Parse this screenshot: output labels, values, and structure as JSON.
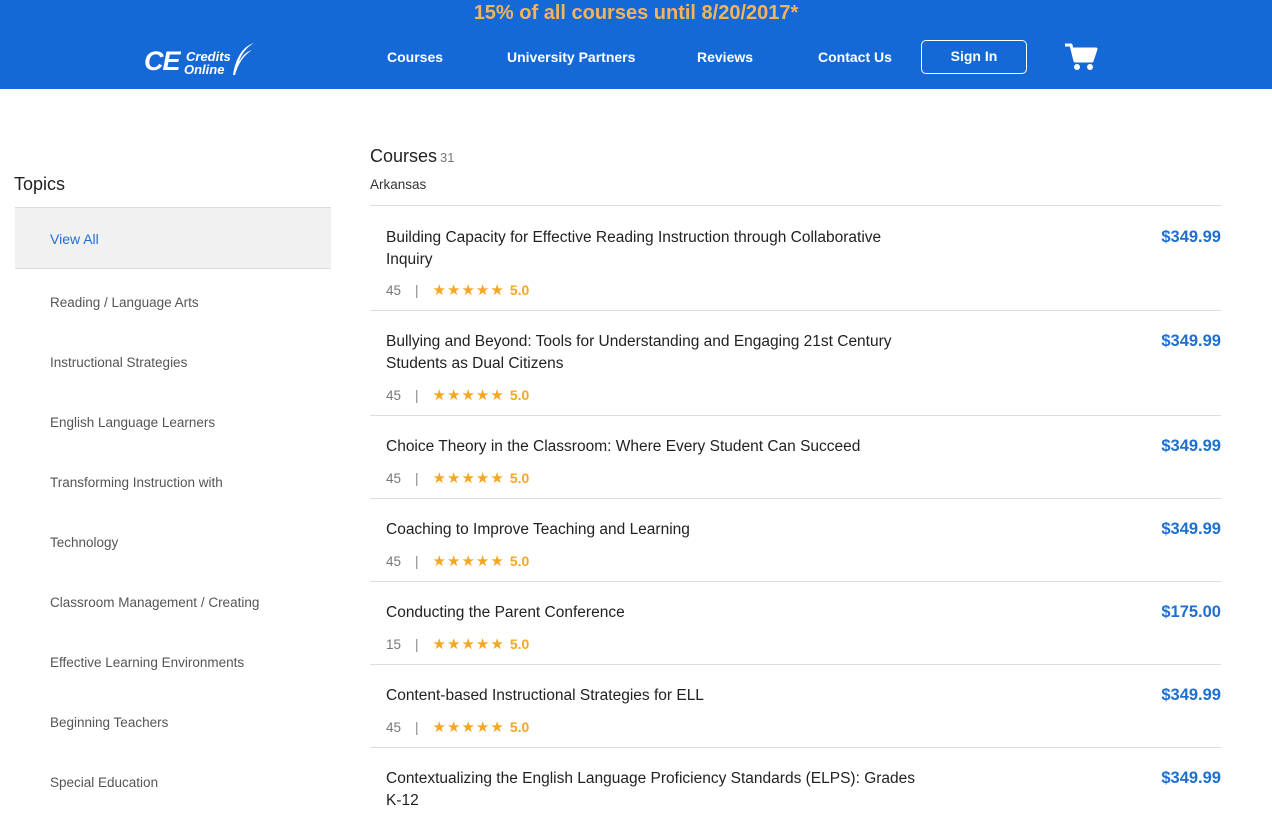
{
  "header": {
    "promo": "15% of all courses until 8/20/2017*",
    "logo": {
      "ce": "CE",
      "credits": "Credits",
      "online": "Online"
    },
    "nav": [
      "Courses",
      "University Partners",
      "Reviews",
      "Contact Us"
    ],
    "signin_label": "Sign In",
    "cart_icon": "shopping-cart-icon"
  },
  "sidebar": {
    "title": "Topics",
    "items": [
      "View All",
      "Reading / Language Arts",
      "Instructional Strategies",
      "English Language Learners",
      "Transforming Instruction with",
      "Technology",
      "Classroom Management / Creating",
      "Effective Learning Environments",
      "Beginning Teachers",
      "Special Education"
    ]
  },
  "main": {
    "title": "Courses",
    "count": "31",
    "state": "Arkansas",
    "courses": [
      {
        "title": "Building Capacity for Effective Reading Instruction through Collaborative Inquiry",
        "hours": "45",
        "rating": "5.0",
        "stars": 5,
        "price": "$349.99"
      },
      {
        "title": "Bullying and Beyond: Tools for Understanding and Engaging 21st Century Students as Dual Citizens",
        "hours": "45",
        "rating": "5.0",
        "stars": 5,
        "price": "$349.99"
      },
      {
        "title": "Choice Theory in the Classroom: Where Every Student Can Succeed",
        "hours": "45",
        "rating": "5.0",
        "stars": 5,
        "price": "$349.99"
      },
      {
        "title": "Coaching to Improve Teaching and Learning",
        "hours": "45",
        "rating": "5.0",
        "stars": 5,
        "price": "$349.99"
      },
      {
        "title": "Conducting the Parent Conference",
        "hours": "15",
        "rating": "5.0",
        "stars": 5,
        "price": "$175.00"
      },
      {
        "title": "Content-based Instructional Strategies for ELL",
        "hours": "45",
        "rating": "5.0",
        "stars": 5,
        "price": "$349.99"
      },
      {
        "title": "Contextualizing the English Language Proficiency Standards (ELPS): Grades K-12",
        "hours": "",
        "rating": "",
        "stars": 0,
        "price": "$349.99"
      }
    ]
  },
  "colors": {
    "brand_blue": "#1469d6",
    "promo_orange": "#f6b35a",
    "link_blue": "#1e6fd0",
    "star": "#f5a623"
  }
}
